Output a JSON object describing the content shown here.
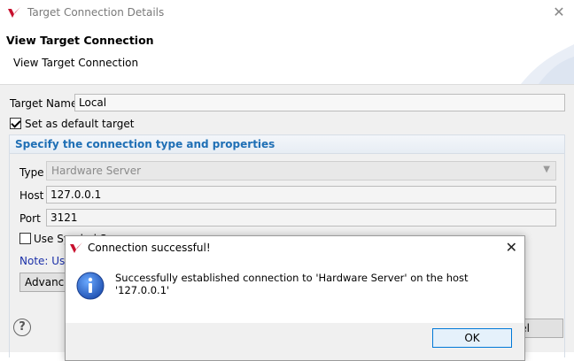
{
  "window": {
    "title": "Target Connection Details",
    "header_title": "View Target Connection",
    "header_subtitle": "View Target Connection"
  },
  "form": {
    "target_name_label": "Target Name",
    "target_name_value": "Local",
    "default_target_label": "Set as default target",
    "default_target_checked": true,
    "section_title": "Specify the connection type and properties",
    "type_label": "Type",
    "type_value": "Hardware Server",
    "host_label": "Host",
    "host_value": "127.0.0.1",
    "port_label": "Port",
    "port_value": "3121",
    "use_symbol_server_label": "Use Symbol S",
    "note_text": "Note: Use",
    "advanced_button": "Advance",
    "cancel_button": "ncel"
  },
  "dialog": {
    "title": "Connection successful!",
    "message": "Successfully established connection to 'Hardware Server' on the host '127.0.0.1'",
    "ok_button": "OK"
  },
  "icons": {
    "app_logo": "vitis-logo-icon",
    "help": "help-icon",
    "info": "info-icon"
  },
  "colors": {
    "accent_blue": "#1f6fb5",
    "brand_red": "#c8102e",
    "note_blue": "#1a2fa8"
  }
}
